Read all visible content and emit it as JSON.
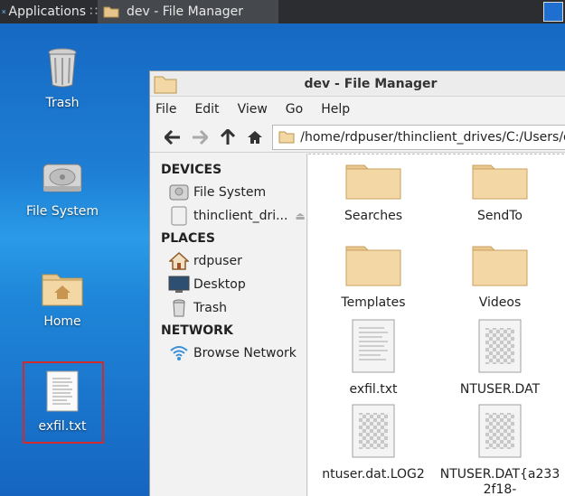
{
  "taskbar": {
    "apps_label": "Applications",
    "apps_suffix": "∷",
    "task_title": "dev - File Manager"
  },
  "desktop": {
    "icons": [
      {
        "label": "Trash"
      },
      {
        "label": "File System"
      },
      {
        "label": "Home"
      },
      {
        "label": "exfil.txt"
      }
    ]
  },
  "window": {
    "title": "dev - File Manager",
    "menu": [
      "File",
      "Edit",
      "View",
      "Go",
      "Help"
    ],
    "path": "/home/rdpuser/thinclient_drives/C:/Users/dev/"
  },
  "sidebar": {
    "devices_heading": "DEVICES",
    "devices": [
      {
        "label": "File System"
      },
      {
        "label": "thinclient_dri..."
      }
    ],
    "places_heading": "PLACES",
    "places": [
      {
        "label": "rdpuser"
      },
      {
        "label": "Desktop"
      },
      {
        "label": "Trash"
      }
    ],
    "network_heading": "NETWORK",
    "network": [
      {
        "label": "Browse Network"
      }
    ]
  },
  "files": [
    {
      "name": "Searches",
      "kind": "folder"
    },
    {
      "name": "SendTo",
      "kind": "folder"
    },
    {
      "name": "Templates",
      "kind": "folder"
    },
    {
      "name": "Videos",
      "kind": "folder"
    },
    {
      "name": "exfil.txt",
      "kind": "text"
    },
    {
      "name": "NTUSER.DAT",
      "kind": "binary"
    },
    {
      "name": "ntuser.dat.LOG2",
      "kind": "binary"
    },
    {
      "name": "NTUSER.DAT{a233\n2f18-",
      "kind": "binary"
    }
  ],
  "colors": {
    "taskbar": "#2b2d30",
    "desktop": "#1e7fd4",
    "selection_box": "#d12b2b",
    "folder": "#f3d7a4"
  }
}
